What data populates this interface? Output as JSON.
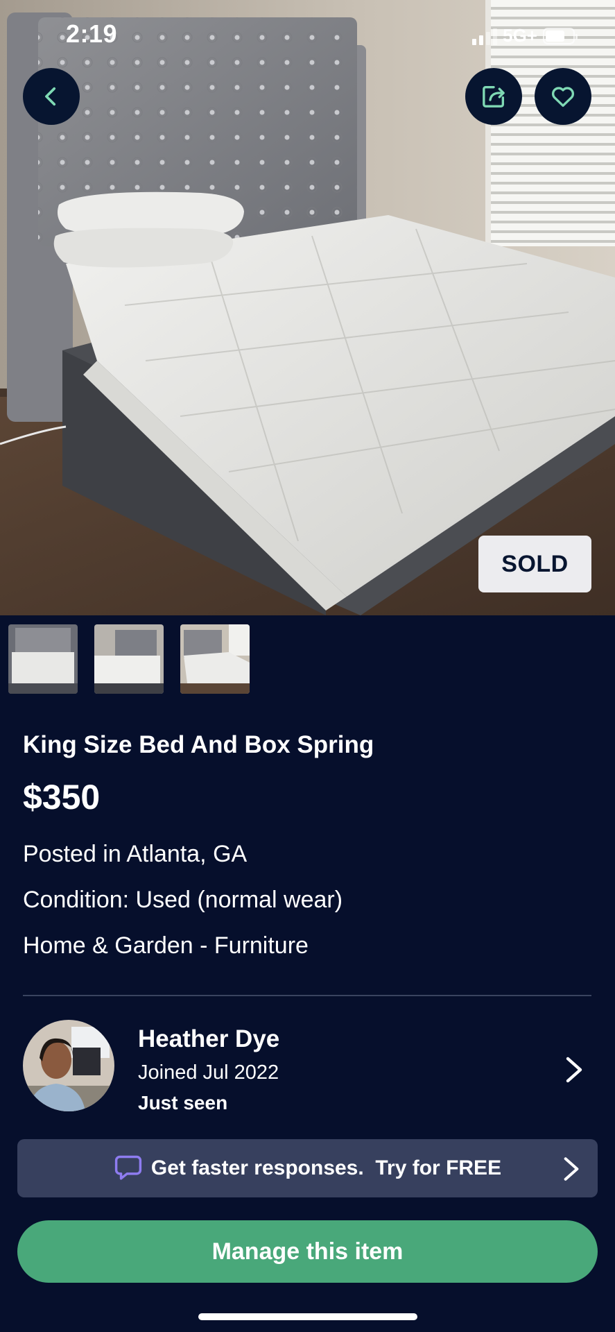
{
  "status_bar": {
    "time": "2:19",
    "network": "5G+",
    "signal_bars_active": 2,
    "signal_bars_total": 4,
    "battery_level": 0.7
  },
  "nav": {
    "back_icon": "chevron-left-icon",
    "share_icon": "share-icon",
    "favorite_icon": "heart-icon"
  },
  "listing": {
    "sold_badge": "SOLD",
    "thumbnail_count": 3,
    "title": "King Size Bed And Box Spring",
    "price": "$350",
    "location": "Posted in Atlanta, GA",
    "condition": "Condition: Used (normal wear)",
    "category": "Home & Garden - Furniture"
  },
  "seller": {
    "name": "Heather Dye",
    "joined": "Joined Jul 2022",
    "last_seen": "Just seen"
  },
  "promo": {
    "icon": "chat-bubble-icon",
    "text": "Get faster responses.  Try for FREE"
  },
  "actions": {
    "manage_label": "Manage this item"
  },
  "colors": {
    "background": "#060f2c",
    "accent_green": "#49a87a",
    "icon_mint": "#7fd9b4",
    "promo_bg": "#37405e",
    "promo_icon": "#8e7cf0"
  }
}
